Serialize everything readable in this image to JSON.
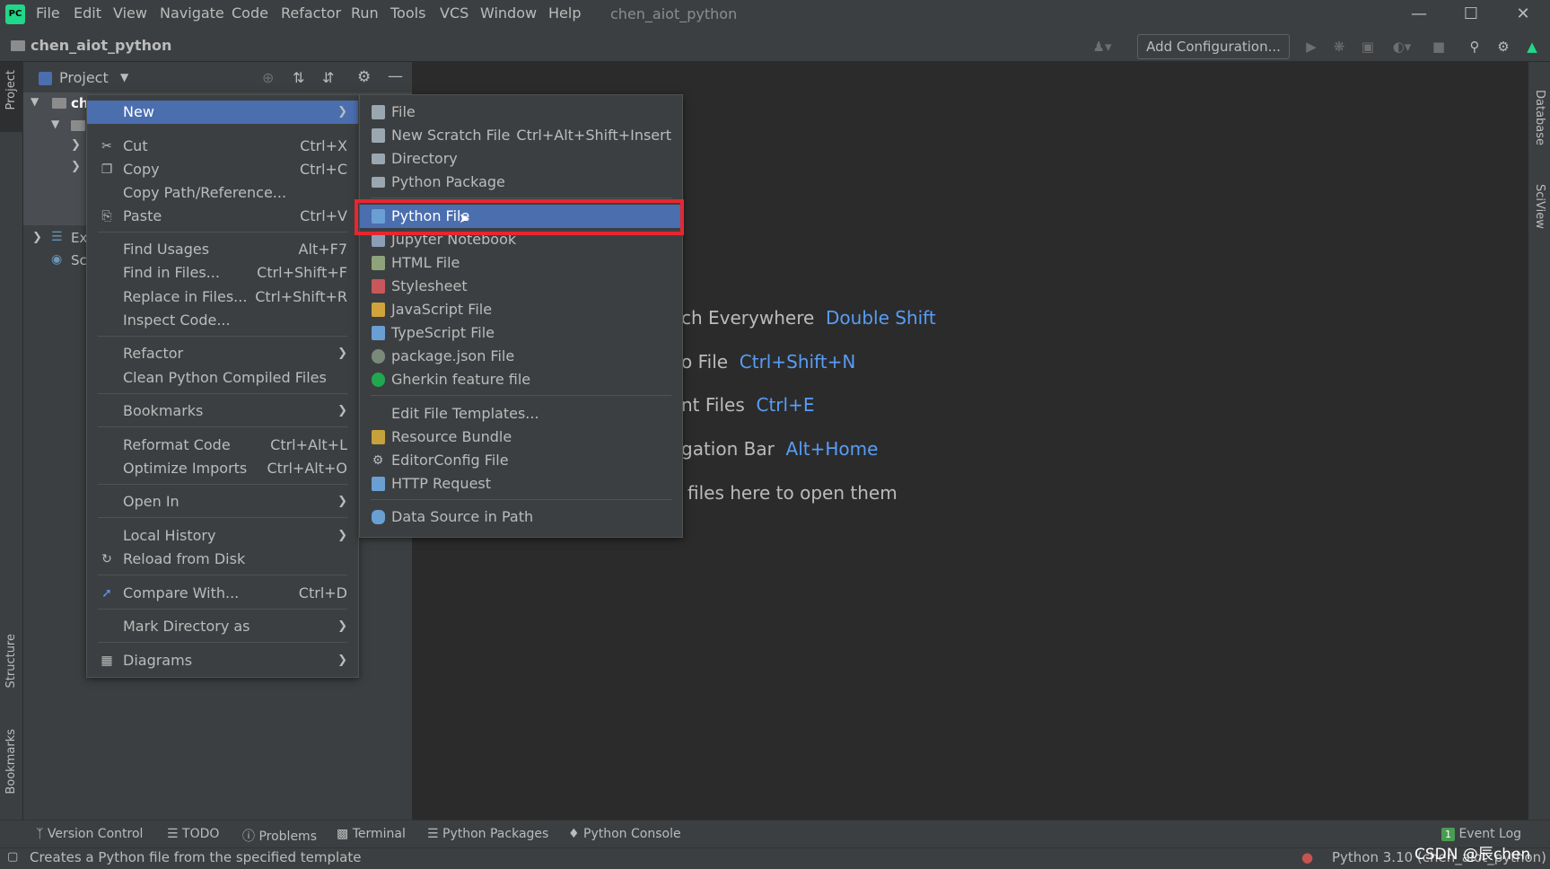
{
  "app": {
    "logo": "PC",
    "title": "chen_aiot_python",
    "menus": [
      "File",
      "Edit",
      "View",
      "Navigate",
      "Code",
      "Refactor",
      "Run",
      "Tools",
      "VCS",
      "Window",
      "Help"
    ]
  },
  "navbar": {
    "project_name": "chen_aiot_python",
    "add_configuration": "Add Configuration..."
  },
  "project_panel": {
    "title": "Project",
    "tree": [
      {
        "label": "ch"
      },
      {
        "label": ""
      },
      {
        "label": ""
      },
      {
        "label": ""
      },
      {
        "label": "Ex"
      },
      {
        "label": "Sc"
      }
    ]
  },
  "left_strip": {
    "project": "Project",
    "structure": "Structure",
    "bookmarks": "Bookmarks"
  },
  "right_strip": {
    "database": "Database",
    "sciview": "SciView"
  },
  "editor_hints": [
    {
      "text": "ch Everywhere",
      "key": "Double Shift"
    },
    {
      "text": "o File",
      "key": "Ctrl+Shift+N"
    },
    {
      "text": "nt Files",
      "key": "Ctrl+E"
    },
    {
      "text": "gation Bar",
      "key": "Alt+Home"
    },
    {
      "text": "files here to open them",
      "key": ""
    }
  ],
  "context_menu": {
    "new": "New",
    "cut": {
      "label": "Cut",
      "shortcut": "Ctrl+X"
    },
    "copy": {
      "label": "Copy",
      "shortcut": "Ctrl+C"
    },
    "copy_path": "Copy Path/Reference...",
    "paste": {
      "label": "Paste",
      "shortcut": "Ctrl+V"
    },
    "find_usages": {
      "label": "Find Usages",
      "shortcut": "Alt+F7"
    },
    "find_in_files": {
      "label": "Find in Files...",
      "shortcut": "Ctrl+Shift+F"
    },
    "replace_in_files": {
      "label": "Replace in Files...",
      "shortcut": "Ctrl+Shift+R"
    },
    "inspect_code": "Inspect Code...",
    "refactor": "Refactor",
    "clean_python": "Clean Python Compiled Files",
    "bookmarks": "Bookmarks",
    "reformat_code": {
      "label": "Reformat Code",
      "shortcut": "Ctrl+Alt+L"
    },
    "optimize_imports": {
      "label": "Optimize Imports",
      "shortcut": "Ctrl+Alt+O"
    },
    "open_in": "Open In",
    "local_history": "Local History",
    "reload_from_disk": "Reload from Disk",
    "compare_with": {
      "label": "Compare With...",
      "shortcut": "Ctrl+D"
    },
    "mark_directory": "Mark Directory as",
    "diagrams": "Diagrams"
  },
  "new_submenu": {
    "file": "File",
    "scratch": {
      "label": "New Scratch File",
      "shortcut": "Ctrl+Alt+Shift+Insert"
    },
    "directory": "Directory",
    "python_package": "Python Package",
    "python_file": "Python File",
    "jupyter": "Jupyter Notebook",
    "html": "HTML File",
    "stylesheet": "Stylesheet",
    "javascript": "JavaScript File",
    "typescript": "TypeScript File",
    "package_json": "package.json File",
    "gherkin": "Gherkin feature file",
    "edit_templates": "Edit File Templates...",
    "resource_bundle": "Resource Bundle",
    "editorconfig": "EditorConfig File",
    "http_request": "HTTP Request",
    "data_source": "Data Source in Path"
  },
  "tool_windows": [
    "Version Control",
    "TODO",
    "Problems",
    "Terminal",
    "Python Packages",
    "Python Console"
  ],
  "event_log": {
    "count": "1",
    "label": "Event Log"
  },
  "status": {
    "message": "Creates a Python file from the specified template",
    "interpreter": "Python 3.10 (chen_aiot_python)",
    "watermark": "CSDN @辰chen"
  },
  "colors": {
    "accent": "#4b6eaf",
    "highlight_box": "#e8262f",
    "link": "#589df6",
    "bg": "#2b2b2b",
    "panel": "#3c3f41"
  }
}
